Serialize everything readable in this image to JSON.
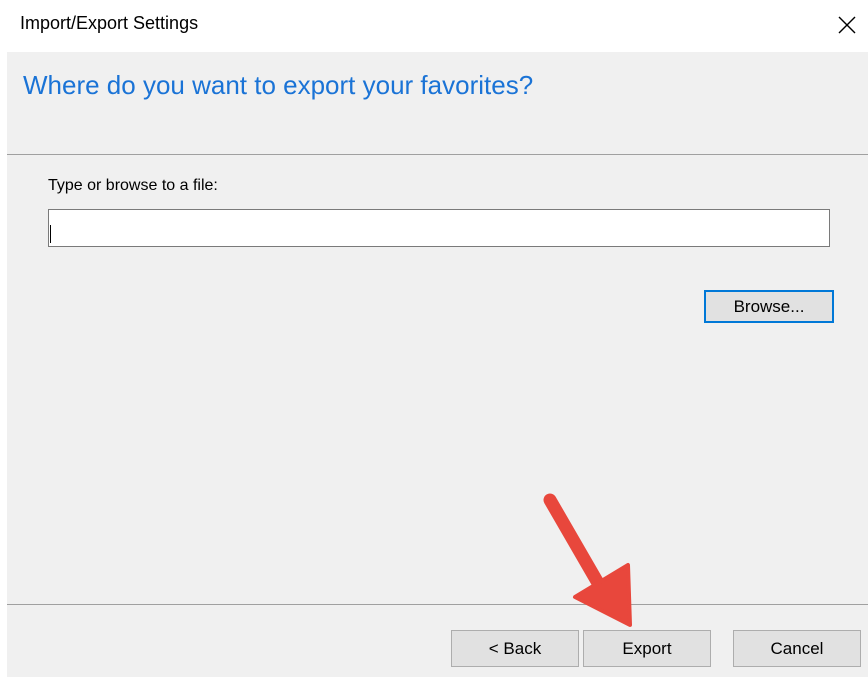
{
  "window": {
    "title": "Import/Export Settings",
    "close_icon": "close-icon"
  },
  "header": {
    "heading": "Where do you want to export your favorites?",
    "heading_color": "#1a73d6"
  },
  "content": {
    "field_label": "Type or browse to a file:",
    "file_input_value": "",
    "browse_label": "Browse..."
  },
  "footer": {
    "back_label": "< Back",
    "export_label": "Export",
    "cancel_label": "Cancel"
  },
  "annotation": {
    "arrow_icon": "red-arrow-icon",
    "arrow_color": "#e8473c"
  }
}
